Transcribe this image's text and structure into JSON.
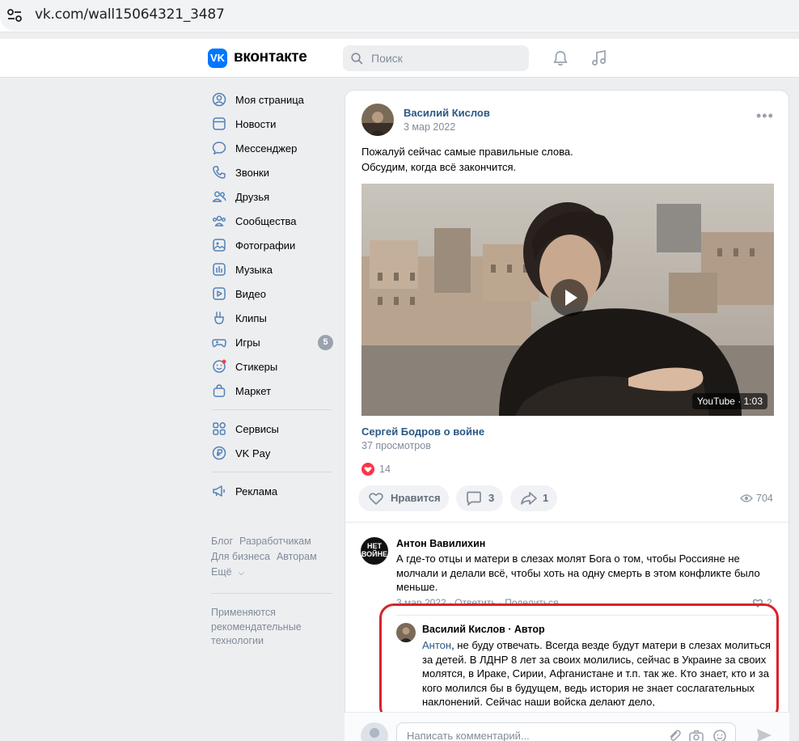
{
  "browser": {
    "url": "vk.com/wall15064321_3487"
  },
  "header": {
    "logo_text": "вконтакте",
    "logo_mark": "VK",
    "search_placeholder": "Поиск"
  },
  "nav": {
    "items": [
      {
        "label": "Моя страница",
        "icon": "user-circle-icon"
      },
      {
        "label": "Новости",
        "icon": "news-icon"
      },
      {
        "label": "Мессенджер",
        "icon": "messenger-icon"
      },
      {
        "label": "Звонки",
        "icon": "phone-icon"
      },
      {
        "label": "Друзья",
        "icon": "friends-icon"
      },
      {
        "label": "Сообщества",
        "icon": "communities-icon"
      },
      {
        "label": "Фотографии",
        "icon": "photo-icon"
      },
      {
        "label": "Музыка",
        "icon": "music-icon"
      },
      {
        "label": "Видео",
        "icon": "video-icon"
      },
      {
        "label": "Клипы",
        "icon": "clips-icon"
      },
      {
        "label": "Игры",
        "icon": "gamepad-icon",
        "badge": "5"
      },
      {
        "label": "Стикеры",
        "icon": "sticker-icon"
      },
      {
        "label": "Маркет",
        "icon": "market-icon"
      }
    ],
    "items2": [
      {
        "label": "Сервисы",
        "icon": "services-icon"
      },
      {
        "label": "VK Pay",
        "icon": "vkpay-icon"
      }
    ],
    "items3": [
      {
        "label": "Реклама",
        "icon": "megaphone-icon"
      }
    ],
    "footer": {
      "blog": "Блог",
      "dev": "Разработчикам",
      "business": "Для бизнеса",
      "authors": "Авторам",
      "more": "Ещё"
    },
    "note": "Применяются рекомендательные технологии"
  },
  "post": {
    "author": "Василий Кислов",
    "date": "3 мар 2022",
    "text_line1": "Пожалуй сейчас самые правильные слова.",
    "text_line2": "Обсудим, когда всё закончится.",
    "video_badge": "YouTube · 1:03",
    "video_title": "Сергей Бодров о войне",
    "video_views": "37 просмотров",
    "reactions": "14",
    "like_label": "Нравится",
    "comments_count": "3",
    "shares_count": "1",
    "views": "704"
  },
  "comments": [
    {
      "author": "Антон Вавилихин",
      "avatar_text": "НЕТ ВОЙНЕ",
      "text": "А где-то отцы и матери в слезах молят Бога о том, чтобы Россияне не молчали и делали всё, чтобы хоть на одну смерть в этом конфликте было меньше.",
      "meta": "3 мар 2022 · Ответить · Поделиться",
      "likes": "2"
    },
    {
      "author": "Василий Кислов · Автор",
      "mention": "Антон",
      "text": ", не буду отвечать. Всегда везде будут матери в слезах молиться за детей. В ЛДНР 8 лет за своих молились, сейчас в Украине за своих молятся, в Ираке, Сирии, Афганистане и т.п. так же. Кто знает, кто и за кого молился бы в будущем, ведь история не знает сослагательных наклонений. Сейчас наши войска делают дело,"
    }
  ],
  "composer": {
    "placeholder": "Написать комментарий..."
  },
  "colors": {
    "accent": "#0077ff",
    "link": "#2a5885",
    "highlight": "#d8232a"
  }
}
